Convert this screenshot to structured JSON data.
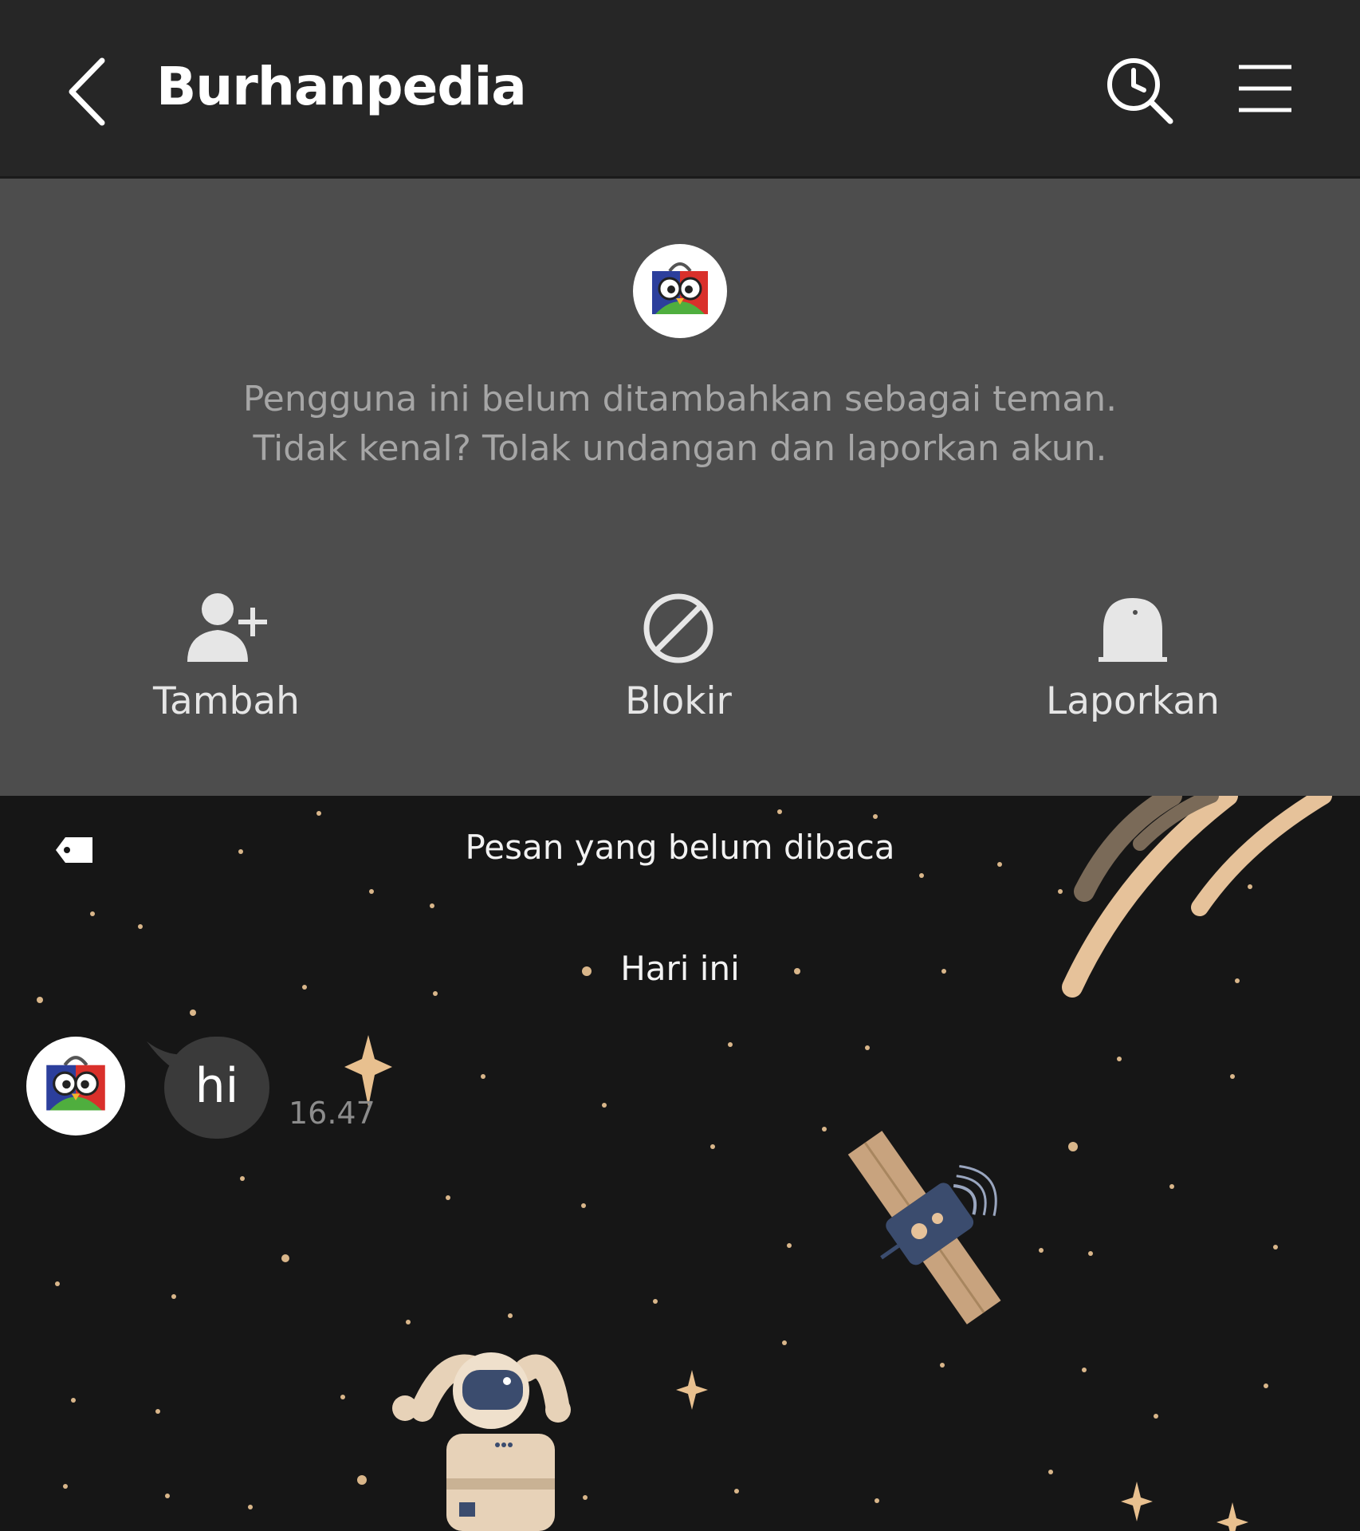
{
  "header": {
    "title": "Burhanpedia",
    "icons": {
      "back": "chevron-left-icon",
      "history": "search-history-icon",
      "menu": "hamburger-menu-icon"
    }
  },
  "panel": {
    "notice_line1": "Pengguna ini belum ditambahkan sebagai teman.",
    "notice_line2": "Tidak kenal? Tolak undangan dan laporkan akun.",
    "actions": [
      {
        "label": "Tambah",
        "icon": "add-friend-icon"
      },
      {
        "label": "Blokir",
        "icon": "block-icon"
      },
      {
        "label": "Laporkan",
        "icon": "report-icon"
      }
    ]
  },
  "chat": {
    "unread_label": "Pesan yang belum dibaca",
    "date_label": "Hari ini",
    "messages": [
      {
        "text": "hi",
        "time": "16.47"
      }
    ]
  },
  "colors": {
    "header_bg": "#262626",
    "panel_bg": "#4d4d4d",
    "chat_bg": "#161616",
    "bubble_bg": "#3a3a3a",
    "star": "#e8c08f"
  }
}
